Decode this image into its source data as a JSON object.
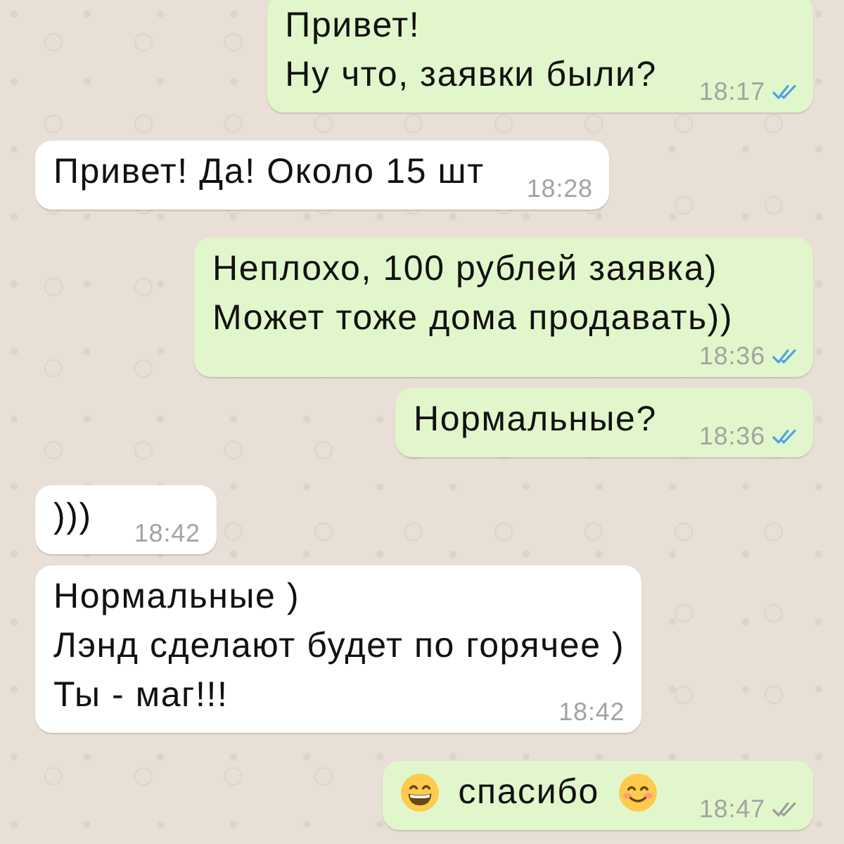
{
  "messages": [
    {
      "kind": "outgoing",
      "lines": [
        "Привет!",
        "Ну что, заявки были?"
      ],
      "time": "18:17",
      "read": true
    },
    {
      "kind": "incoming",
      "lines": [
        "Привет! Да! Около 15 шт"
      ],
      "time": "18:28"
    },
    {
      "kind": "outgoing",
      "lines": [
        "Неплохо, 100 рублей заявка)",
        "Может тоже дома продавать))"
      ],
      "time": "18:36",
      "read": true
    },
    {
      "kind": "outgoing",
      "lines": [
        "Нормальные?"
      ],
      "time": "18:36",
      "read": true
    },
    {
      "kind": "incoming",
      "lines": [
        ")))"
      ],
      "time": "18:42"
    },
    {
      "kind": "incoming",
      "lines": [
        "Нормальные )",
        "Лэнд сделают будет по горячее )",
        "Ты - маг!!!"
      ],
      "time": "18:42"
    },
    {
      "kind": "outgoing",
      "parts": [
        {
          "kind": "grin"
        },
        {
          "kind": "text",
          "text": "спасибо"
        },
        {
          "kind": "smile"
        }
      ],
      "time": "18:47",
      "read": false
    }
  ]
}
